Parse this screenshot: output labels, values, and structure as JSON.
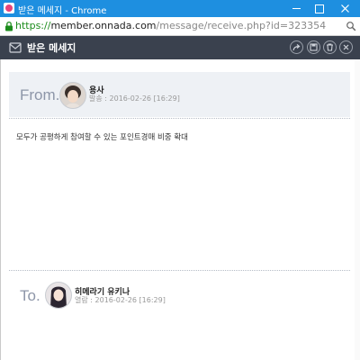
{
  "window": {
    "title": "받은 메세지",
    "browser": "Chrome",
    "controls": {
      "minimize": "minimize",
      "maximize": "maximize",
      "close": "close"
    }
  },
  "address_bar": {
    "scheme": "https://",
    "host": "member.onnada.com",
    "path": "/message/receive.php?id=323354",
    "secure_color": "#1c8c1c"
  },
  "header": {
    "title": "받은 메세지",
    "background": "#3a414e",
    "actions": [
      "reply-icon",
      "save-icon",
      "delete-icon",
      "close-icon"
    ]
  },
  "from": {
    "label": "From.",
    "name": "용사",
    "meta_label": "발송 : ",
    "date": "2016-02-26 [16:29]"
  },
  "message": {
    "body": "모두가 공평하게 참여할 수 있는 포인트경매 비중 확대"
  },
  "to": {
    "label": "To.",
    "name": "히메라기 유키나",
    "meta_label": "열람 : ",
    "date": "2016-02-26 [16:29]"
  },
  "colors": {
    "titlebar": "#1e8fe0",
    "from_box": "#eef1f5",
    "label": "#8d96a8"
  }
}
